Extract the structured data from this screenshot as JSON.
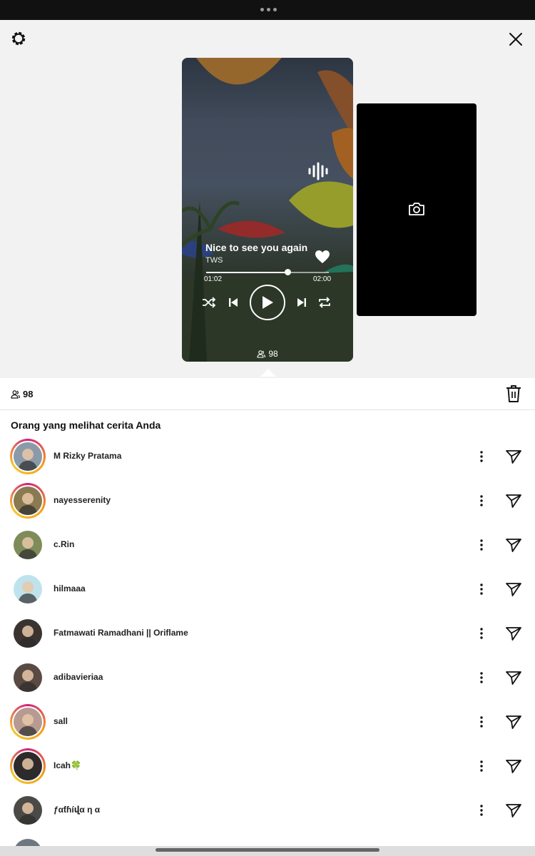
{
  "story": {
    "song_title": "Nice to see you again",
    "artist": "TWS",
    "time_elapsed": "01:02",
    "time_total": "02:00",
    "progress": 0.66,
    "card_viewer_count": "98"
  },
  "sheet": {
    "viewer_count": "98",
    "section_title": "Orang yang melihat cerita Anda"
  },
  "viewers": [
    {
      "name": "M Rizky Pratama",
      "has_story": true,
      "avatar_color": "#8a9aa8"
    },
    {
      "name": "nayesserenity",
      "has_story": true,
      "avatar_color": "#8a7a52"
    },
    {
      "name": "c.Rin",
      "has_story": false,
      "avatar_color": "#7f8c5a"
    },
    {
      "name": "hilmaaa",
      "has_story": false,
      "avatar_color": "#bfe3ec"
    },
    {
      "name": "Fatmawati Ramadhani || Oriflame",
      "has_story": false,
      "avatar_color": "#3a3330"
    },
    {
      "name": "adibavieriaa",
      "has_story": false,
      "avatar_color": "#5a4a44"
    },
    {
      "name": "sall",
      "has_story": true,
      "avatar_color": "#b79a92"
    },
    {
      "name": "Icah🍀",
      "has_story": true,
      "avatar_color": "#2e2a2c"
    },
    {
      "name": "ƒαƭɦíվα η α",
      "has_story": false,
      "avatar_color": "#4b4a47"
    }
  ]
}
